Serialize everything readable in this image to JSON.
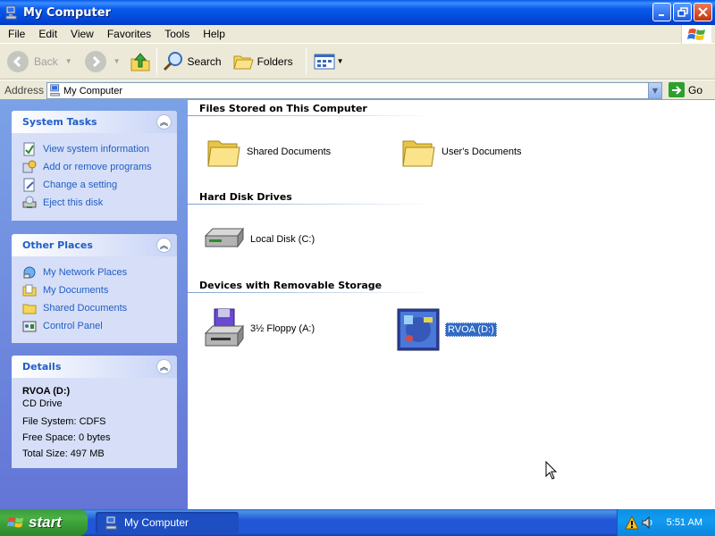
{
  "window": {
    "title": "My Computer",
    "icon": "my-computer-icon"
  },
  "menu": [
    "File",
    "Edit",
    "View",
    "Favorites",
    "Tools",
    "Help"
  ],
  "toolbar": {
    "back": "Back",
    "search": "Search",
    "folders": "Folders"
  },
  "address": {
    "label": "Address",
    "value": "My Computer",
    "go": "Go"
  },
  "system_tasks": {
    "title": "System Tasks",
    "items": [
      "View system information",
      "Add or remove programs",
      "Change a setting",
      "Eject this disk"
    ]
  },
  "other_places": {
    "title": "Other Places",
    "items": [
      "My Network Places",
      "My Documents",
      "Shared Documents",
      "Control Panel"
    ]
  },
  "details": {
    "title": "Details",
    "name": "RVOA (D:)",
    "type": "CD Drive",
    "file_system": "File System: CDFS",
    "free_space": "Free Space: 0 bytes",
    "total_size": "Total Size: 497 MB"
  },
  "groups": {
    "files": {
      "title": "Files Stored on This Computer",
      "items": [
        "Shared Documents",
        "User's Documents"
      ]
    },
    "hdd": {
      "title": "Hard Disk Drives",
      "items": [
        "Local Disk (C:)"
      ]
    },
    "removable": {
      "title": "Devices with Removable Storage",
      "items": [
        "3½ Floppy (A:)",
        "RVOA (D:)"
      ]
    }
  },
  "taskbar": {
    "start": "start",
    "task": "My Computer",
    "clock": "5:51 AM"
  },
  "colors": {
    "titlebar": "#0a5be8",
    "link_blue": "#215dc6",
    "selection": "#316ac5",
    "start_green": "#3c9a3c"
  }
}
